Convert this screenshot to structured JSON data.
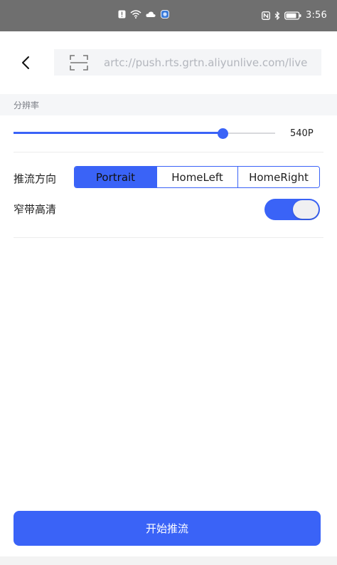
{
  "status_bar": {
    "time": "3:56",
    "left_icons": [
      "notification-icon",
      "wifi-icon",
      "cloud-icon",
      "app-icon"
    ],
    "right_icons": [
      "nfc-icon",
      "bluetooth-icon",
      "battery-icon"
    ]
  },
  "header": {
    "back_icon": "chevron-left-icon",
    "scan_icon": "scan-icon",
    "url_value": "artc://push.rts.grtn.aliyunlive.com/live"
  },
  "resolution": {
    "section_label": "分辨率",
    "value_label": "540P",
    "slider_fraction": 0.8
  },
  "orientation": {
    "label": "推流方向",
    "options": [
      "Portrait",
      "HomeLeft",
      "HomeRight"
    ],
    "selected": "Portrait"
  },
  "narrowband_hd": {
    "label": "窄带高清",
    "enabled": true
  },
  "start_button": {
    "label": "开始推流"
  },
  "colors": {
    "accent": "#3a63f7",
    "status_bar_bg": "#6f6f6f",
    "section_bg": "#f5f6f8"
  }
}
